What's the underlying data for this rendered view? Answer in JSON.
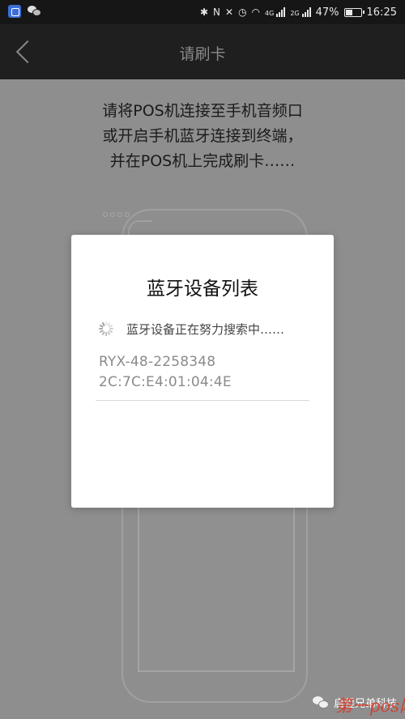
{
  "status_bar": {
    "network_label": "4G",
    "network2_label": "2G",
    "battery": "47%",
    "battery_level": 0.47,
    "time": "16:25"
  },
  "header": {
    "title": "请刷卡",
    "back_icon": "chevron-left-icon"
  },
  "instructions": {
    "line1": "请将POS机连接至手机音频口",
    "line2": "或开启手机蓝牙连接到终端，",
    "line3": "并在POS机上完成刷卡……"
  },
  "dialog": {
    "title": "蓝牙设备列表",
    "searching_text": "蓝牙设备正在努力搜索中……",
    "devices": [
      {
        "name": "RYX-48-2258348",
        "mac": "2C:7C:E4:01:04:4E"
      }
    ]
  },
  "watermark": {
    "source_text": "启程兄弟科技",
    "site_text": "第一pos网"
  },
  "colors": {
    "overlay_bg": "#8e8e8e",
    "header_bg": "#1f1f1f",
    "dialog_bg": "#ffffff",
    "watermark_red": "#d83a2a"
  }
}
